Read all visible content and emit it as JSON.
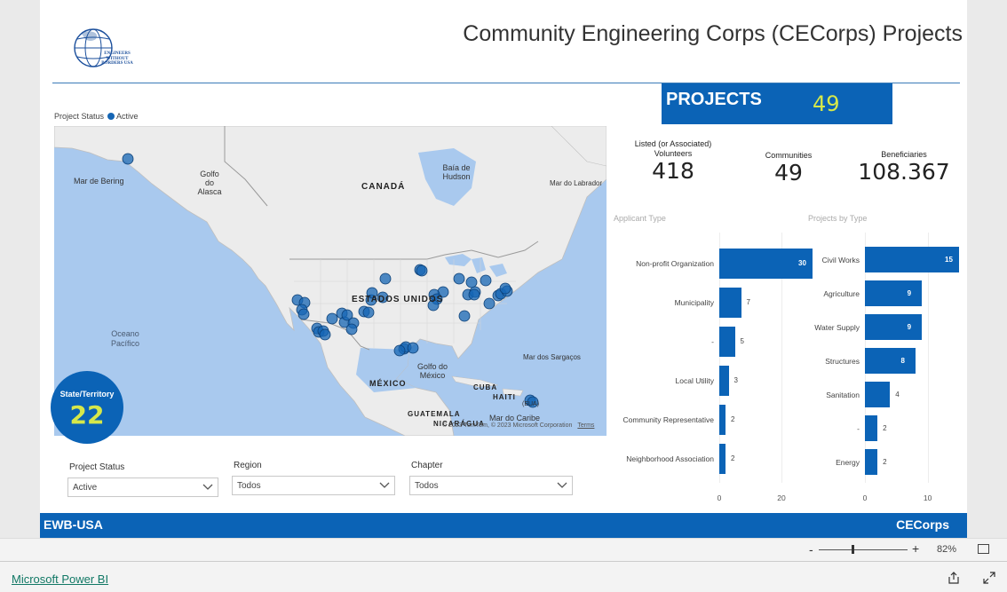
{
  "report": {
    "title": "Community Engineering Corps (CECorps) Projects",
    "logo_text": "ENGINEERS WITHOUT BORDERS USA"
  },
  "projects_kpi": {
    "label": "PROJECTS",
    "value": "49"
  },
  "map": {
    "legend_title": "Project Status",
    "legend_item": "Active",
    "labels": {
      "bering": "Mar de Bering",
      "alaska": "Golfo do Alasca",
      "canada": "CANADÁ",
      "hudson": "Baía de Hudson",
      "labrador": "Mar do Labrador",
      "usa": "ESTADOS UNIDOS",
      "pacific": "Oceano Pacífico",
      "sargassos": "Mar dos Sargaços",
      "mexico_gulf": "Golfo do México",
      "mexico": "MÉXICO",
      "cuba": "CUBA",
      "haiti": "HAITI",
      "guatemala": "GUATEMALA",
      "nicaragua": "NICARÁGUA",
      "caribe": "Mar do Caribe",
      "usa_short": "(EUA)"
    },
    "copyright": "© 2023 TomTom, © 2023 Microsoft Corporation",
    "terms": "Terms",
    "dot_color": "#1565b4"
  },
  "state_kpi": {
    "label": "State/Territory",
    "value": "22"
  },
  "slicers": {
    "status": {
      "label": "Project Status",
      "value": "Active"
    },
    "region": {
      "label": "Region",
      "value": "Todos"
    },
    "chapter": {
      "label": "Chapter",
      "value": "Todos"
    }
  },
  "kpis": {
    "volunteers": {
      "caption1": "Listed (or Associated)",
      "caption2": "Volunteers",
      "value": "418"
    },
    "communities": {
      "caption": "Communities",
      "value": "49"
    },
    "beneficiaries": {
      "caption": "Beneficiaries",
      "value": "108.367"
    }
  },
  "chart_data": [
    {
      "type": "bar",
      "orientation": "horizontal",
      "title": "Applicant Type",
      "categories": [
        "Non-profit Organization",
        "Municipality",
        "-",
        "Local Utility",
        "Community Representative",
        "Neighborhood Association"
      ],
      "values": [
        30,
        7,
        5,
        3,
        2,
        2
      ],
      "xticks": [
        0,
        20
      ],
      "xlim": [
        0,
        30
      ],
      "color": "#0b63b6"
    },
    {
      "type": "bar",
      "orientation": "horizontal",
      "title": "Projects by Type",
      "categories": [
        "Civil Works",
        "Agriculture",
        "Water Supply",
        "Structures",
        "Sanitation",
        "-",
        "Energy"
      ],
      "values": [
        15,
        9,
        9,
        8,
        4,
        2,
        2
      ],
      "xticks": [
        0,
        10
      ],
      "xlim": [
        0,
        15
      ],
      "color": "#0b63b6"
    }
  ],
  "footer": {
    "left": "EWB-USA",
    "right": "CECorps"
  },
  "zoom": {
    "minus": "-",
    "plus": "+",
    "percent": "82%"
  },
  "bottom": {
    "brand": "Microsoft Power BI"
  },
  "colors": {
    "accent": "#0b63b6",
    "highlight": "#d6e84a"
  }
}
